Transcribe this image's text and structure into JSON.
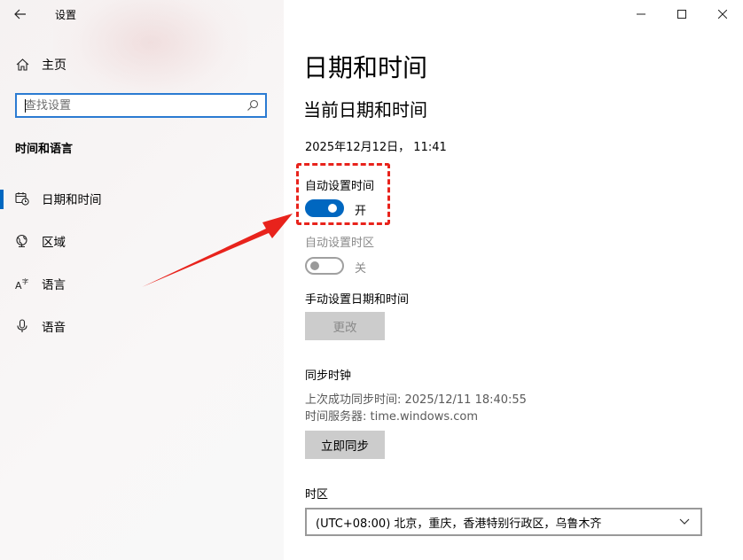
{
  "window": {
    "app_title": "设置",
    "controls": {
      "minimize": "minimize-icon",
      "maximize": "maximize-icon",
      "close": "close-icon"
    }
  },
  "sidebar": {
    "home_label": "主页",
    "search_placeholder": "查找设置",
    "section_title": "时间和语言",
    "items": [
      {
        "label": "日期和时间",
        "icon": "calendar-clock-icon",
        "active": true
      },
      {
        "label": "区域",
        "icon": "globe-icon",
        "active": false
      },
      {
        "label": "语言",
        "icon": "language-icon",
        "active": false
      },
      {
        "label": "语音",
        "icon": "microphone-icon",
        "active": false
      }
    ]
  },
  "main": {
    "page_title": "日期和时间",
    "section_title": "当前日期和时间",
    "current_datetime": "2025年12月12日， 11:41",
    "auto_time": {
      "label": "自动设置时间",
      "state_text": "开",
      "on": true
    },
    "auto_timezone": {
      "label": "自动设置时区",
      "state_text": "关",
      "on": false
    },
    "manual": {
      "label": "手动设置日期和时间",
      "button": "更改"
    },
    "sync": {
      "title": "同步时钟",
      "last_sync": "上次成功同步时间: 2025/12/11 18:40:55",
      "server": "时间服务器: time.windows.com",
      "button": "立即同步"
    },
    "timezone": {
      "label": "时区",
      "selected": "(UTC+08:00) 北京，重庆，香港特别行政区，乌鲁木齐"
    }
  },
  "annotation": {
    "color": "#e8231c"
  },
  "colors": {
    "accent": "#0067c0",
    "button_bg": "#cccccc",
    "disabled_text": "#8a8a8a"
  }
}
